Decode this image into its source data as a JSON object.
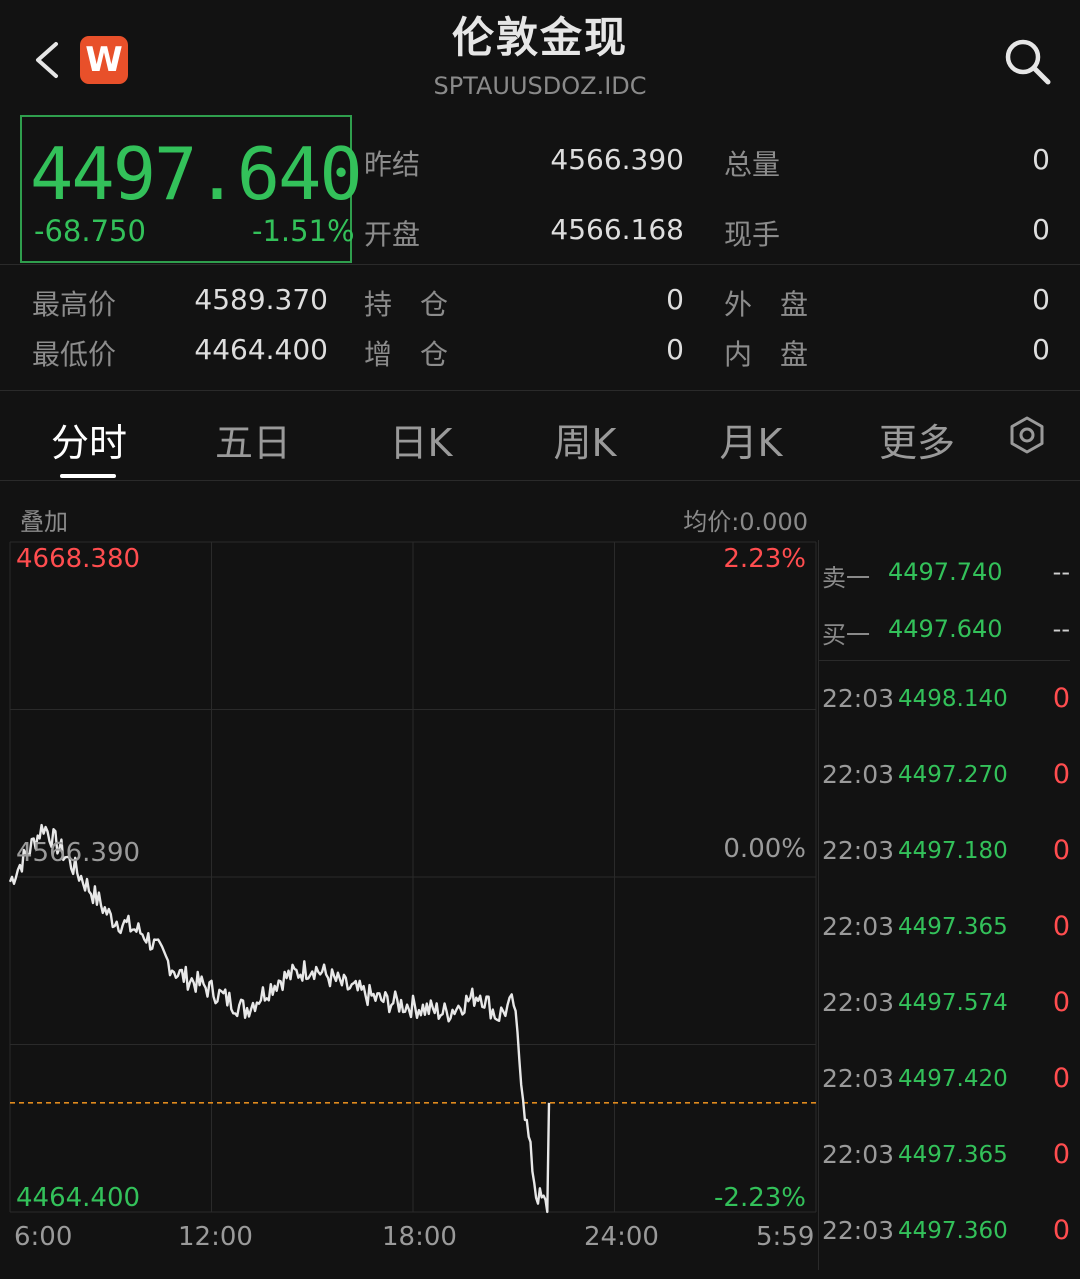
{
  "header": {
    "title": "伦敦金现",
    "symbol": "SPTAUUSDOZ.IDC",
    "logo_letter": "W"
  },
  "quote": {
    "price": "4497.640",
    "change": "-68.750",
    "change_pct": "-1.51%",
    "rows": [
      {
        "label": "昨结",
        "value": "4566.390",
        "label2": "总量",
        "value2": "0"
      },
      {
        "label": "开盘",
        "value": "4566.168",
        "label2": "现手",
        "value2": "0"
      }
    ],
    "rows2": [
      {
        "label": "最高价",
        "value": "4589.370",
        "label2": "持　仓",
        "value2": "0",
        "label3": "外　盘",
        "value3": "0"
      },
      {
        "label": "最低价",
        "value": "4464.400",
        "label2": "增　仓",
        "value2": "0",
        "label3": "内　盘",
        "value3": "0"
      }
    ]
  },
  "tabs": [
    "分时",
    "五日",
    "日K",
    "周K",
    "月K",
    "更多"
  ],
  "active_tab": "分时",
  "chart": {
    "overlay_label": "叠加",
    "avg_label": "均价:0.000",
    "max_price": "4668.380",
    "max_pct": "2.23%",
    "ref_price": "4566.390",
    "ref_pct": "0.00%",
    "min_price": "4464.400",
    "min_pct": "-2.23%",
    "x_labels": [
      "6:00",
      "12:00",
      "18:00",
      "24:00",
      "5:59"
    ],
    "colors": {
      "up": "#ff4d4f",
      "down": "#33c15a",
      "line": "#e8e8e8",
      "ref": "#e08a1e"
    }
  },
  "chart_data": {
    "type": "line",
    "ylim": [
      4464.4,
      4668.38
    ],
    "reference": 4566.39,
    "x": [
      "6:00",
      "7:00",
      "8:00",
      "9:00",
      "10:00",
      "11:00",
      "12:00",
      "13:00",
      "14:00",
      "15:00",
      "16:00",
      "17:00",
      "18:00",
      "19:00",
      "20:00",
      "20:30",
      "21:00",
      "21:20",
      "21:40",
      "22:00",
      "22:03"
    ],
    "values": [
      4565,
      4582,
      4568,
      4554,
      4549,
      4537,
      4532,
      4526,
      4535,
      4539,
      4533,
      4529,
      4527,
      4525,
      4531,
      4524,
      4528,
      4495,
      4470,
      4466,
      4497.64
    ]
  },
  "orderbook": [
    {
      "label": "卖一",
      "price": "4497.740",
      "vol": "--"
    },
    {
      "label": "买一",
      "price": "4497.640",
      "vol": "--"
    }
  ],
  "ticks": [
    {
      "time": "22:03",
      "price": "4498.140",
      "vol": "0"
    },
    {
      "time": "22:03",
      "price": "4497.270",
      "vol": "0"
    },
    {
      "time": "22:03",
      "price": "4497.180",
      "vol": "0"
    },
    {
      "time": "22:03",
      "price": "4497.365",
      "vol": "0"
    },
    {
      "time": "22:03",
      "price": "4497.574",
      "vol": "0"
    },
    {
      "time": "22:03",
      "price": "4497.420",
      "vol": "0"
    },
    {
      "time": "22:03",
      "price": "4497.365",
      "vol": "0"
    },
    {
      "time": "22:03",
      "price": "4497.360",
      "vol": "0"
    }
  ]
}
